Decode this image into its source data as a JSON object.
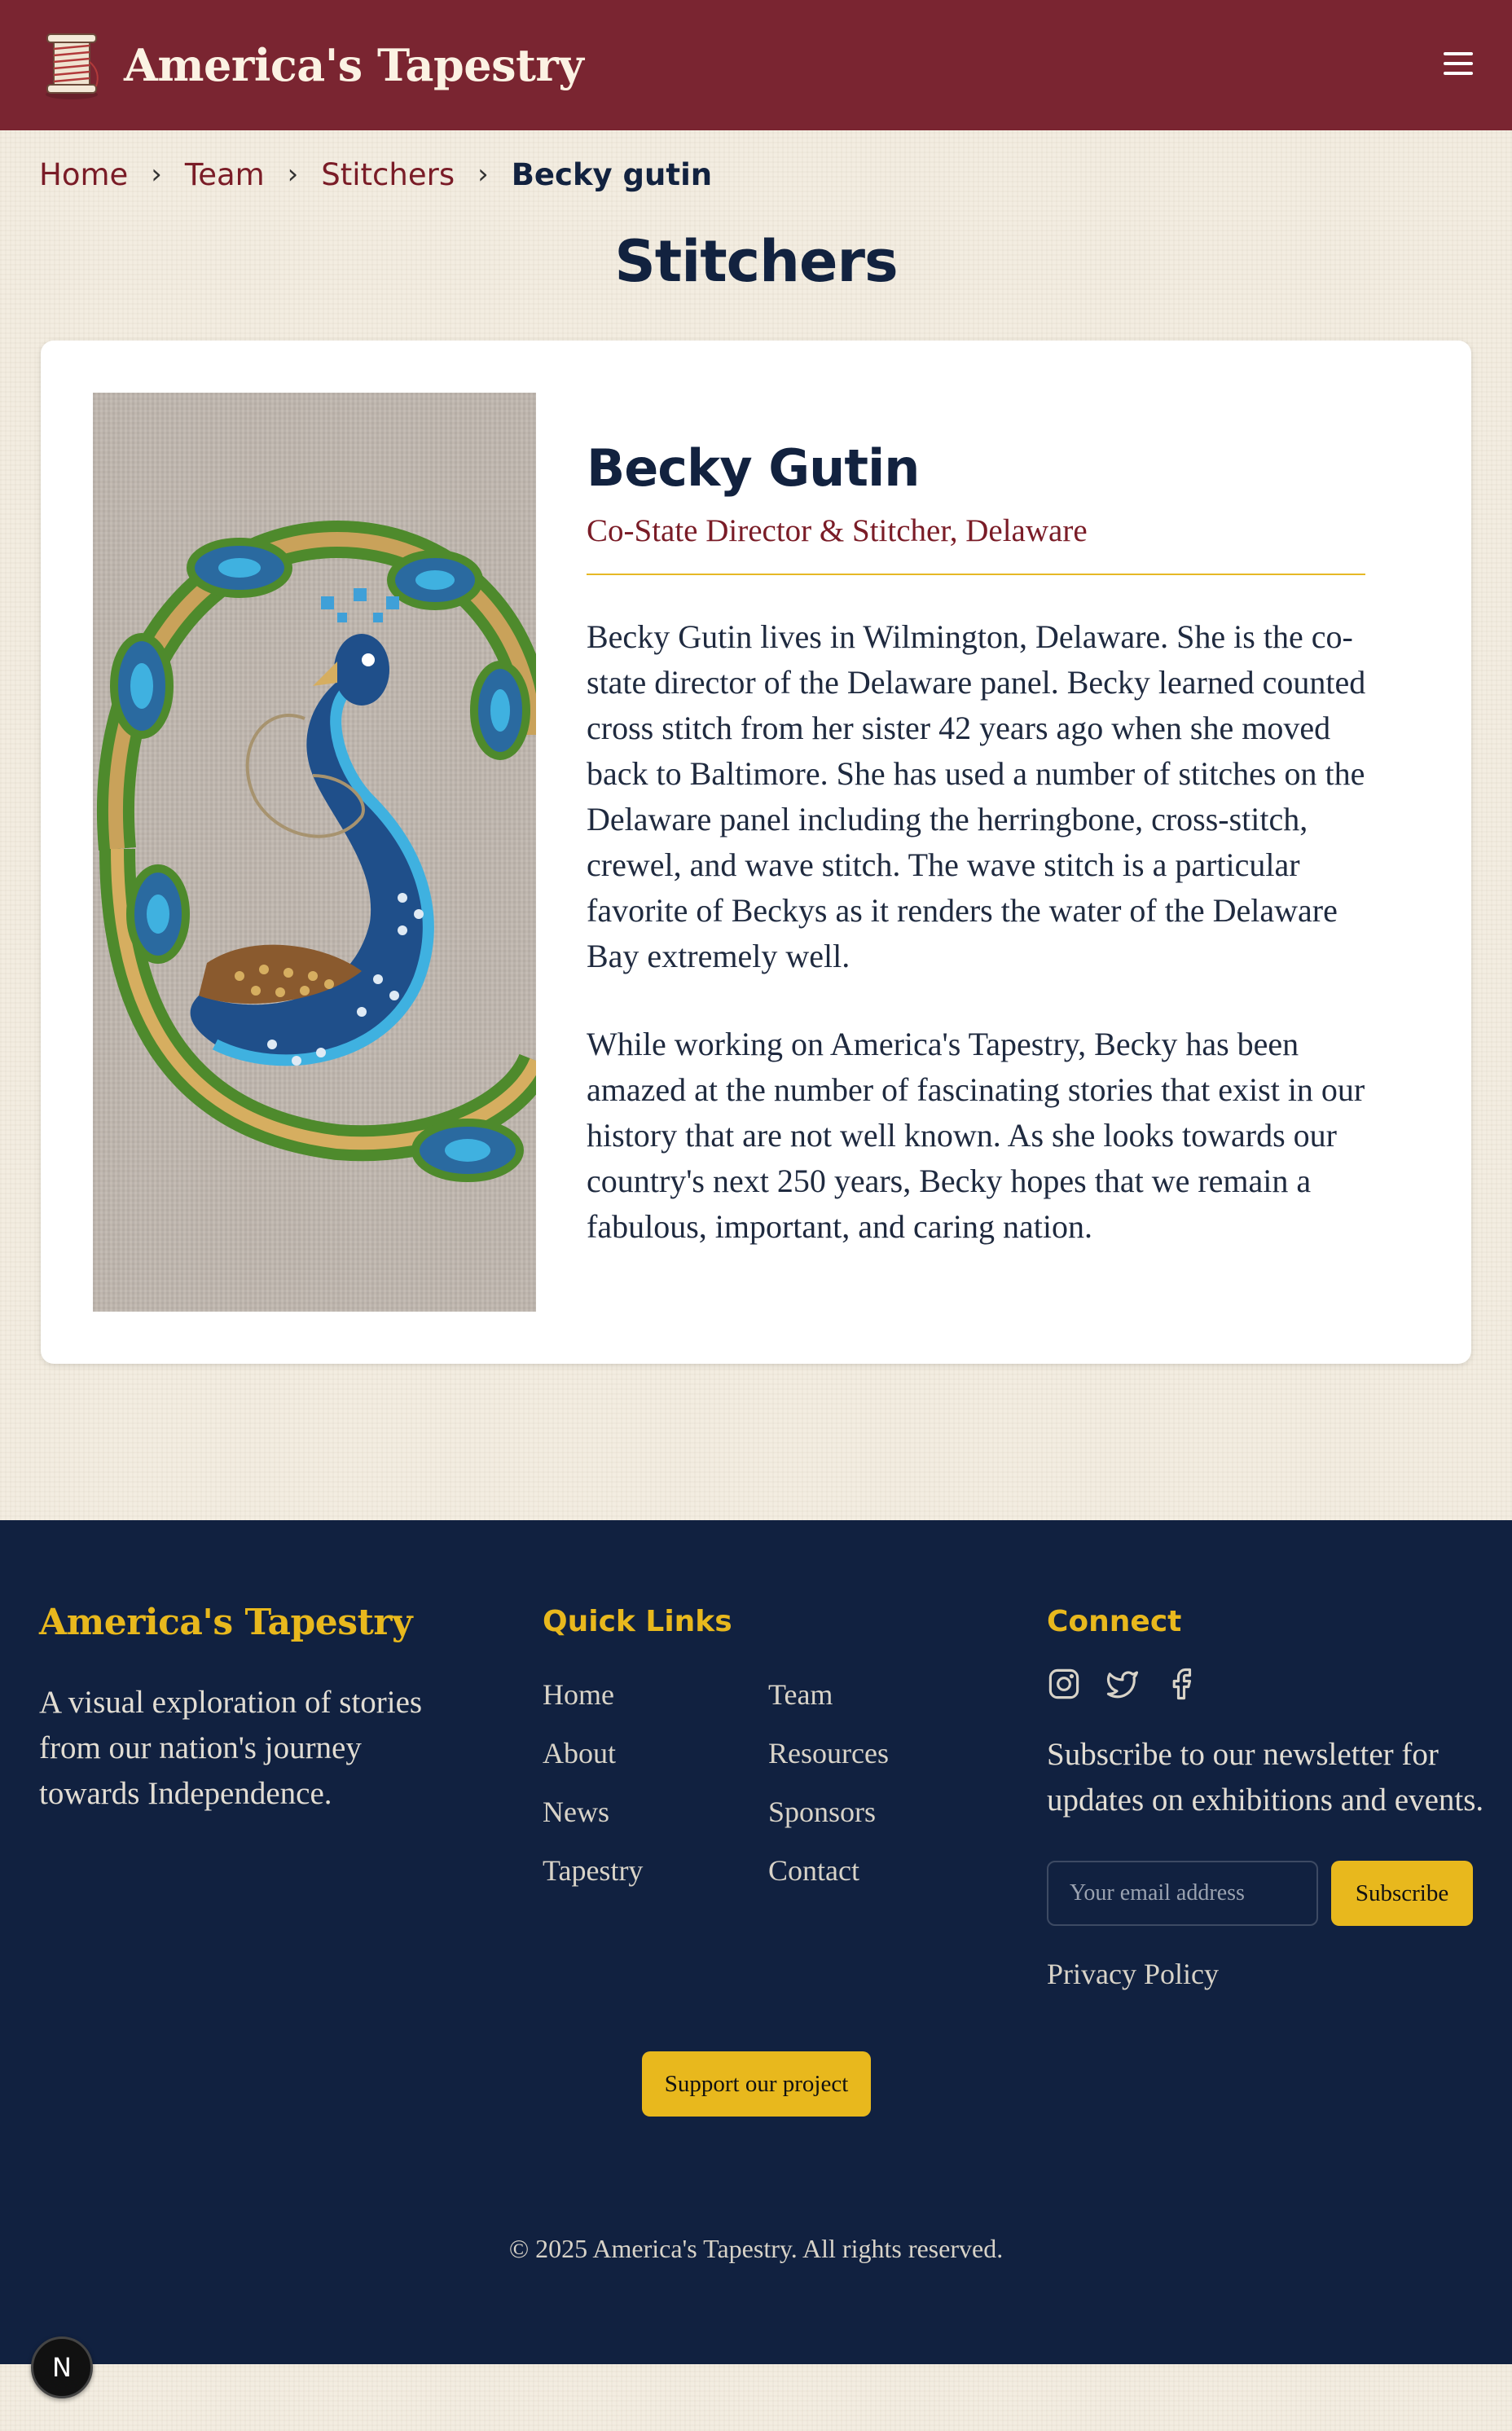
{
  "header": {
    "site_title": "America's Tapestry",
    "logo_icon": "thread-spool-icon",
    "menu_icon": "hamburger-menu-icon"
  },
  "breadcrumb": {
    "items": [
      "Home",
      "Team",
      "Stitchers"
    ],
    "current": "Becky gutin",
    "separator": "›"
  },
  "page": {
    "heading": "Stitchers"
  },
  "profile": {
    "name": "Becky Gutin",
    "role": "Co-State Director & Stitcher, Delaware",
    "bio": [
      "Becky Gutin lives in Wilmington, Delaware. She is the co-state director of the Delaware panel. Becky learned counted cross stitch from her sister 42 years ago when she moved back to Baltimore. She has used a number of stitches on the Delaware panel including the herringbone, cross-stitch, crewel, and wave stitch. The wave stitch is a particular favorite of Beckys as it renders the water of the Delaware Bay extremely well.",
      "While working on America's Tapestry, Becky has been amazed at the number of fascinating stories that exist in our history that are not well known. As she looks towards our country's next 250 years, Becky hopes that we remain a fabulous, important, and caring nation."
    ]
  },
  "footer": {
    "brand": "America's Tapestry",
    "tagline": "A visual exploration of stories from our nation's journey towards Independence.",
    "quick_links_title": "Quick Links",
    "quick_links": [
      "Home",
      "Team",
      "About",
      "Resources",
      "News",
      "Sponsors",
      "Tapestry",
      "Contact"
    ],
    "connect_title": "Connect",
    "social_icons": [
      "instagram-icon",
      "twitter-icon",
      "facebook-icon"
    ],
    "newsletter_text": "Subscribe to our newsletter for updates on exhibitions and events.",
    "email_placeholder": "Your email address",
    "subscribe_label": "Subscribe",
    "privacy_label": "Privacy Policy",
    "support_label": "Support our project",
    "copyright": "© 2025 America's Tapestry. All rights reserved."
  },
  "dev_badge": "N",
  "colors": {
    "header_bg": "#7a2531",
    "accent_gold": "#e8b81d",
    "footer_bg": "#112140",
    "link_maroon": "#7a1c27"
  }
}
